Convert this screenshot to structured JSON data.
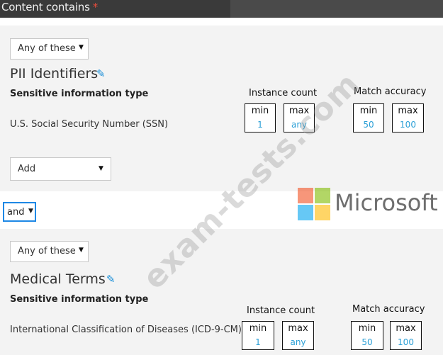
{
  "header": {
    "title": "Content contains",
    "required_mark": "*"
  },
  "group1": {
    "match_select": "Any of these",
    "title": "PII Identifiers",
    "column_header": "Sensitive information type",
    "instance_count_label": "Instance count",
    "match_accuracy_label": "Match accuracy",
    "type_name": "U.S. Social Security Number (SSN)",
    "instance_min_label": "min",
    "instance_min_value": "1",
    "instance_max_label": "max",
    "instance_max_value": "any",
    "accuracy_min_label": "min",
    "accuracy_min_value": "50",
    "accuracy_max_label": "max",
    "accuracy_max_value": "100",
    "add_select": "Add"
  },
  "operator": {
    "value": "and"
  },
  "branding": {
    "logo_text": "Microsoft",
    "logo_colors": [
      "#f25022",
      "#7fba00",
      "#00a4ef",
      "#ffb900"
    ]
  },
  "watermark": {
    "text": "exam-tests.com"
  },
  "group2": {
    "match_select": "Any of these",
    "title": "Medical Terms",
    "column_header": "Sensitive information type",
    "instance_count_label": "Instance count",
    "match_accuracy_label": "Match accuracy",
    "type_name": "International Classification of Diseases (ICD-9-CM)",
    "instance_min_label": "min",
    "instance_min_value": "1",
    "instance_max_label": "max",
    "instance_max_value": "any",
    "accuracy_min_label": "min",
    "accuracy_min_value": "50",
    "accuracy_max_label": "max",
    "accuracy_max_value": "100"
  },
  "icons": {
    "caret": "▼",
    "edit": "✎"
  }
}
